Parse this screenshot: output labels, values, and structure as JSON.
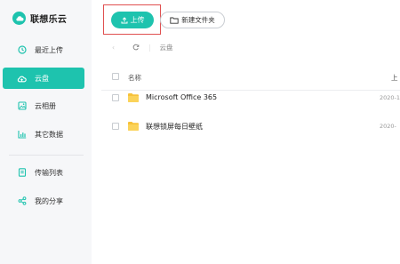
{
  "app": {
    "name": "联想乐云"
  },
  "sidebar": {
    "items": [
      {
        "label": "最近上传",
        "icon": "clock-icon"
      },
      {
        "label": "云盘",
        "icon": "cloud-icon",
        "active": true
      },
      {
        "label": "云相册",
        "icon": "image-icon"
      },
      {
        "label": "其它数据",
        "icon": "chart-icon"
      },
      {
        "label": "传输列表",
        "icon": "list-icon"
      },
      {
        "label": "我的分享",
        "icon": "share-icon"
      }
    ]
  },
  "toolbar": {
    "upload_label": "上传",
    "new_folder_label": "新建文件夹"
  },
  "breadcrumb": {
    "back": "‹",
    "path": "云盘"
  },
  "table": {
    "header": {
      "name": "名称",
      "date": "上"
    },
    "rows": [
      {
        "name": "Microsoft Office 365",
        "date": "2020-1",
        "icon": "folder-icon"
      },
      {
        "name": "联想锁屏每日壁纸",
        "date": "2020-",
        "icon": "folder-icon"
      }
    ]
  },
  "colors": {
    "accent": "#1ec3ae",
    "folder": "#f7c23a",
    "highlight_box": "#e05050",
    "sidebar_bg": "#f6f7f9"
  }
}
